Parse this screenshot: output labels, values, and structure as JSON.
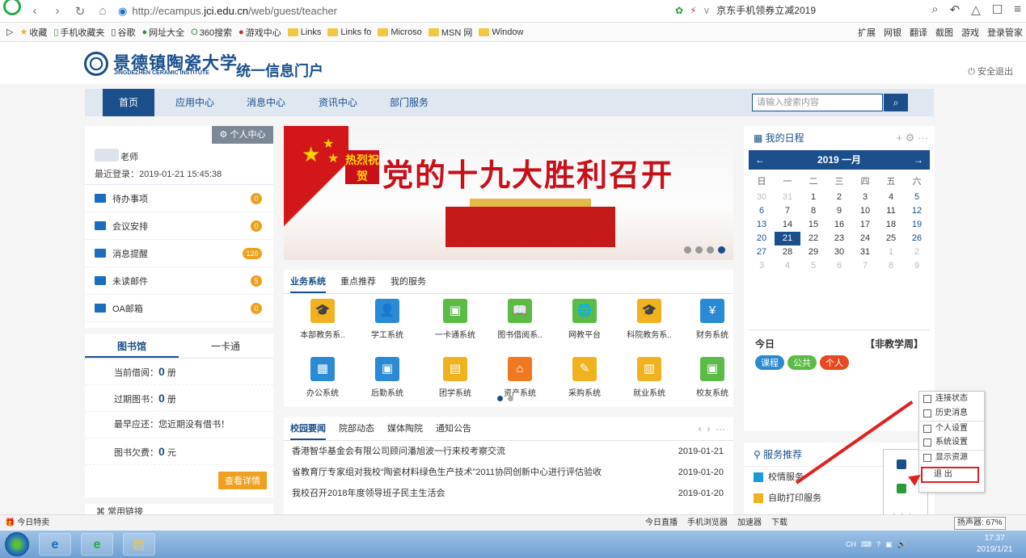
{
  "browser": {
    "url_prefix": "http://ecampus.",
    "url_domain": "jci.edu.cn",
    "url_suffix": "/web/guest/teacher",
    "ad_text": "京东手机领券立减2019",
    "bookmarks": [
      "收藏",
      "手机收藏夹",
      "谷歌",
      "网址大全",
      "360搜索",
      "游戏中心",
      "Links",
      "Links fo",
      "Microso",
      "MSN 网",
      "Window"
    ],
    "right_tools": [
      "扩展",
      "网银",
      "翻译",
      "截图",
      "游戏",
      "登录管家"
    ]
  },
  "site": {
    "school_cn": "景德镇陶瓷大学",
    "school_en": "JINGDEZHEN CERAMIC INSTITUTE",
    "portal_title": "统一信息门户",
    "logout": "安全退出",
    "nav": [
      "首页",
      "应用中心",
      "消息中心",
      "资讯中心",
      "部门服务"
    ],
    "search_placeholder": "请输入搜索内容"
  },
  "profile": {
    "center": "个人中心",
    "role": "老师",
    "last_login": "最近登录：2019-01-21 15:45:38",
    "menu": [
      {
        "label": "待办事项",
        "count": "0"
      },
      {
        "label": "会议安排",
        "count": "0"
      },
      {
        "label": "消息提醒",
        "count": "126"
      },
      {
        "label": "未读邮件",
        "count": "5"
      },
      {
        "label": "OA邮箱",
        "count": "0"
      }
    ]
  },
  "library": {
    "tabs": [
      "图书馆",
      "一卡通"
    ],
    "rows": [
      {
        "label": "当前借阅：",
        "value": "0",
        "unit": "册"
      },
      {
        "label": "过期图书：",
        "value": "0",
        "unit": "册"
      },
      {
        "label": "最早应还：您近期没有借书！",
        "value": "",
        "unit": ""
      },
      {
        "label": "图书欠费：",
        "value": "0",
        "unit": "元"
      }
    ],
    "detail_button": "查看详情",
    "common_links": "常用链接"
  },
  "banner": {
    "tag": "热烈祝贺",
    "headline": "党的十九大胜利召开"
  },
  "services": {
    "tabs": [
      "业务系统",
      "重点推荐",
      "我的服务"
    ],
    "items": [
      {
        "label": "本部教务系..",
        "color": "#f0b21e",
        "icon": "🎓"
      },
      {
        "label": "学工系统",
        "color": "#2a8ad3",
        "icon": "👤"
      },
      {
        "label": "一卡通系统",
        "color": "#5bbb46",
        "icon": "▣"
      },
      {
        "label": "图书借阅系..",
        "color": "#5bbb46",
        "icon": "📖"
      },
      {
        "label": "网教平台",
        "color": "#5bbb46",
        "icon": "🌐"
      },
      {
        "label": "科院教务系..",
        "color": "#f0b21e",
        "icon": "🎓"
      },
      {
        "label": "财务系统",
        "color": "#2a8ad3",
        "icon": "¥"
      },
      {
        "label": "办公系统",
        "color": "#2a8ad3",
        "icon": "▦"
      },
      {
        "label": "后勤系统",
        "color": "#2a8ad3",
        "icon": "▣"
      },
      {
        "label": "团学系统",
        "color": "#f0b21e",
        "icon": "▤"
      },
      {
        "label": "资产系统",
        "color": "#f07820",
        "icon": "⌂"
      },
      {
        "label": "采购系统",
        "color": "#f0b21e",
        "icon": "✎"
      },
      {
        "label": "就业系统",
        "color": "#f0b21e",
        "icon": "▥"
      },
      {
        "label": "校友系统",
        "color": "#5bbb46",
        "icon": "▣"
      }
    ]
  },
  "news": {
    "tabs": [
      "校园要闻",
      "院部动态",
      "媒体陶院",
      "通知公告"
    ],
    "items": [
      {
        "title": "香港智华基金会有限公司顾问潘旭波一行来校考察交流",
        "date": "2019-01-21"
      },
      {
        "title": "省教育厅专家组对我校“陶瓷材料绿色生产技术”2011协同创新中心进行评估验收",
        "date": "2019-01-20"
      },
      {
        "title": "我校召开2018年度领导班子民主生活会",
        "date": "2019-01-20"
      }
    ]
  },
  "calendar": {
    "title": "我的日程",
    "month": "2019 一月",
    "weekdays": [
      "日",
      "一",
      "二",
      "三",
      "四",
      "五",
      "六"
    ],
    "days": [
      [
        "30",
        "31",
        "1",
        "2",
        "3",
        "4",
        "5"
      ],
      [
        "6",
        "7",
        "8",
        "9",
        "10",
        "11",
        "12"
      ],
      [
        "13",
        "14",
        "15",
        "16",
        "17",
        "18",
        "19"
      ],
      [
        "20",
        "21",
        "22",
        "23",
        "24",
        "25",
        "26"
      ],
      [
        "27",
        "28",
        "29",
        "30",
        "31",
        "1",
        "2"
      ],
      [
        "3",
        "4",
        "5",
        "6",
        "7",
        "8",
        "9"
      ]
    ],
    "today_label": "今日",
    "week_label": "【非教学周】",
    "chips": [
      {
        "label": "课程",
        "color": "#2a8ad3"
      },
      {
        "label": "公共",
        "color": "#5bbb46"
      },
      {
        "label": "个人",
        "color": "#e8491f"
      }
    ]
  },
  "service_rec": {
    "title": "服务推荐",
    "items": [
      "校情服务",
      "自助打印服务"
    ]
  },
  "context_menu": {
    "items": [
      "连接状态",
      "历史消息",
      "个人设置",
      "系统设置",
      "显示资源",
      "退 出"
    ],
    "custom": "自定义..."
  },
  "status_bar": {
    "left": "今日特卖",
    "items": [
      "今日直播",
      "手机浏览器",
      "加速器",
      "下载"
    ],
    "zoom": "扬声器: 67%"
  },
  "taskbar": {
    "tray_text": "CH",
    "time": "17:37",
    "date": "2019/1/21"
  }
}
